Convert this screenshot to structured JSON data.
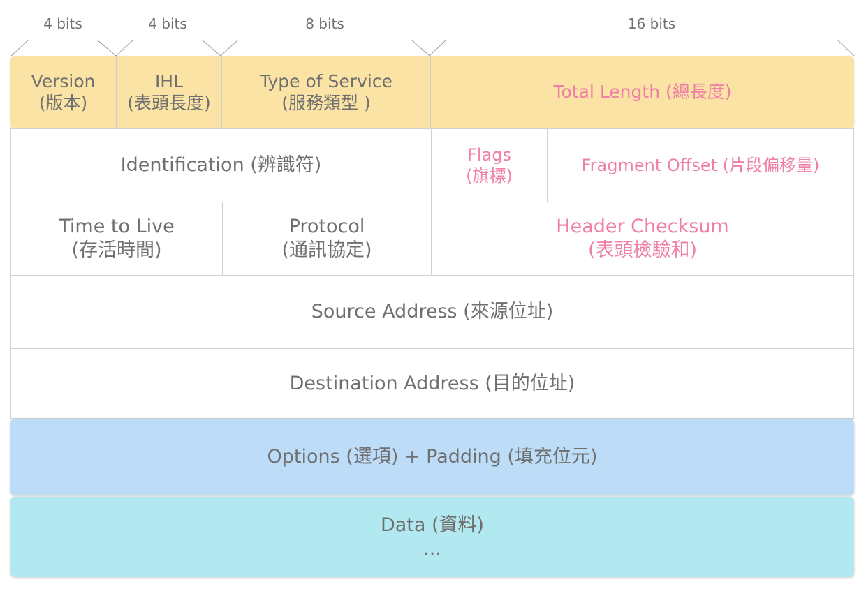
{
  "bit_widths": [
    "4 bits",
    "4 bits",
    "8 bits",
    "16 bits"
  ],
  "fields": {
    "version": {
      "en": "Version",
      "zh": "(版本)"
    },
    "ihl": {
      "en": "IHL",
      "zh": "(表頭長度)"
    },
    "tos": {
      "en": "Type of Service",
      "zh": "(服務類型 )"
    },
    "total_length": {
      "label": "Total Length (總長度)"
    },
    "identification": {
      "label": "Identification (辨識符)"
    },
    "flags": {
      "en": "Flags",
      "zh": "(旗標)"
    },
    "fragment_offset": {
      "label": "Fragment Offset (片段偏移量)"
    },
    "ttl": {
      "en": "Time to Live",
      "zh": "(存活時間)"
    },
    "protocol": {
      "en": "Protocol",
      "zh": "(通訊協定)"
    },
    "checksum": {
      "en": "Header Checksum",
      "zh": "(表頭檢驗和)"
    },
    "source": {
      "label": "Source Address (來源位址)"
    },
    "destination": {
      "label": "Destination Address (目的位址)"
    },
    "options": {
      "label": "Options (選項) + Padding (填充位元)"
    },
    "data": {
      "label": "Data (資料)",
      "ellipsis": "..."
    }
  },
  "colors": {
    "row1": "#fae3a4",
    "options": "#bcdcf7",
    "data": "#b2e9f0",
    "highlight_text": "#ef7fa6",
    "text": "#6f6f6f"
  }
}
